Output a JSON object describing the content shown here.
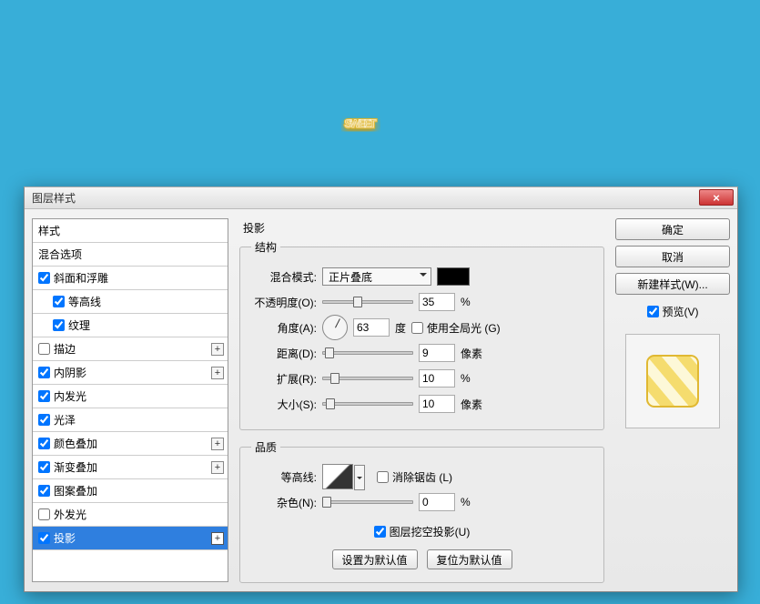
{
  "dialog": {
    "title": "图层样式"
  },
  "styles": {
    "header": "样式",
    "blendOptions": "混合选项",
    "items": [
      {
        "label": "斜面和浮雕",
        "checked": true,
        "plus": false
      },
      {
        "label": "等高线",
        "checked": true,
        "plus": false,
        "indent": true
      },
      {
        "label": "纹理",
        "checked": true,
        "plus": false,
        "indent": true
      },
      {
        "label": "描边",
        "checked": false,
        "plus": true
      },
      {
        "label": "内阴影",
        "checked": true,
        "plus": true
      },
      {
        "label": "内发光",
        "checked": true,
        "plus": false
      },
      {
        "label": "光泽",
        "checked": true,
        "plus": false
      },
      {
        "label": "颜色叠加",
        "checked": true,
        "plus": true
      },
      {
        "label": "渐变叠加",
        "checked": true,
        "plus": true
      },
      {
        "label": "图案叠加",
        "checked": true,
        "plus": false
      },
      {
        "label": "外发光",
        "checked": false,
        "plus": false
      },
      {
        "label": "投影",
        "checked": true,
        "plus": true,
        "selected": true
      }
    ]
  },
  "panel": {
    "title": "投影",
    "structureLegend": "结构",
    "qualityLegend": "品质",
    "blendMode": {
      "label": "混合模式:",
      "value": "正片叠底"
    },
    "opacity": {
      "label": "不透明度(O):",
      "value": "35",
      "unit": "%"
    },
    "angle": {
      "label": "角度(A):",
      "value": "63",
      "unit": "度",
      "globalLight": "使用全局光 (G)",
      "globalChecked": false
    },
    "distance": {
      "label": "距离(D):",
      "value": "9",
      "unit": "像素"
    },
    "spread": {
      "label": "扩展(R):",
      "value": "10",
      "unit": "%"
    },
    "size": {
      "label": "大小(S):",
      "value": "10",
      "unit": "像素"
    },
    "contour": {
      "label": "等高线:",
      "antialias": "消除锯齿 (L)",
      "antialiasChecked": false
    },
    "noise": {
      "label": "杂色(N):",
      "value": "0",
      "unit": "%"
    },
    "knockout": {
      "label": "图层挖空投影(U)",
      "checked": true
    },
    "makeDefault": "设置为默认值",
    "resetDefault": "复位为默认值"
  },
  "right": {
    "ok": "确定",
    "cancel": "取消",
    "newStyle": "新建样式(W)...",
    "preview": "预览(V)"
  }
}
